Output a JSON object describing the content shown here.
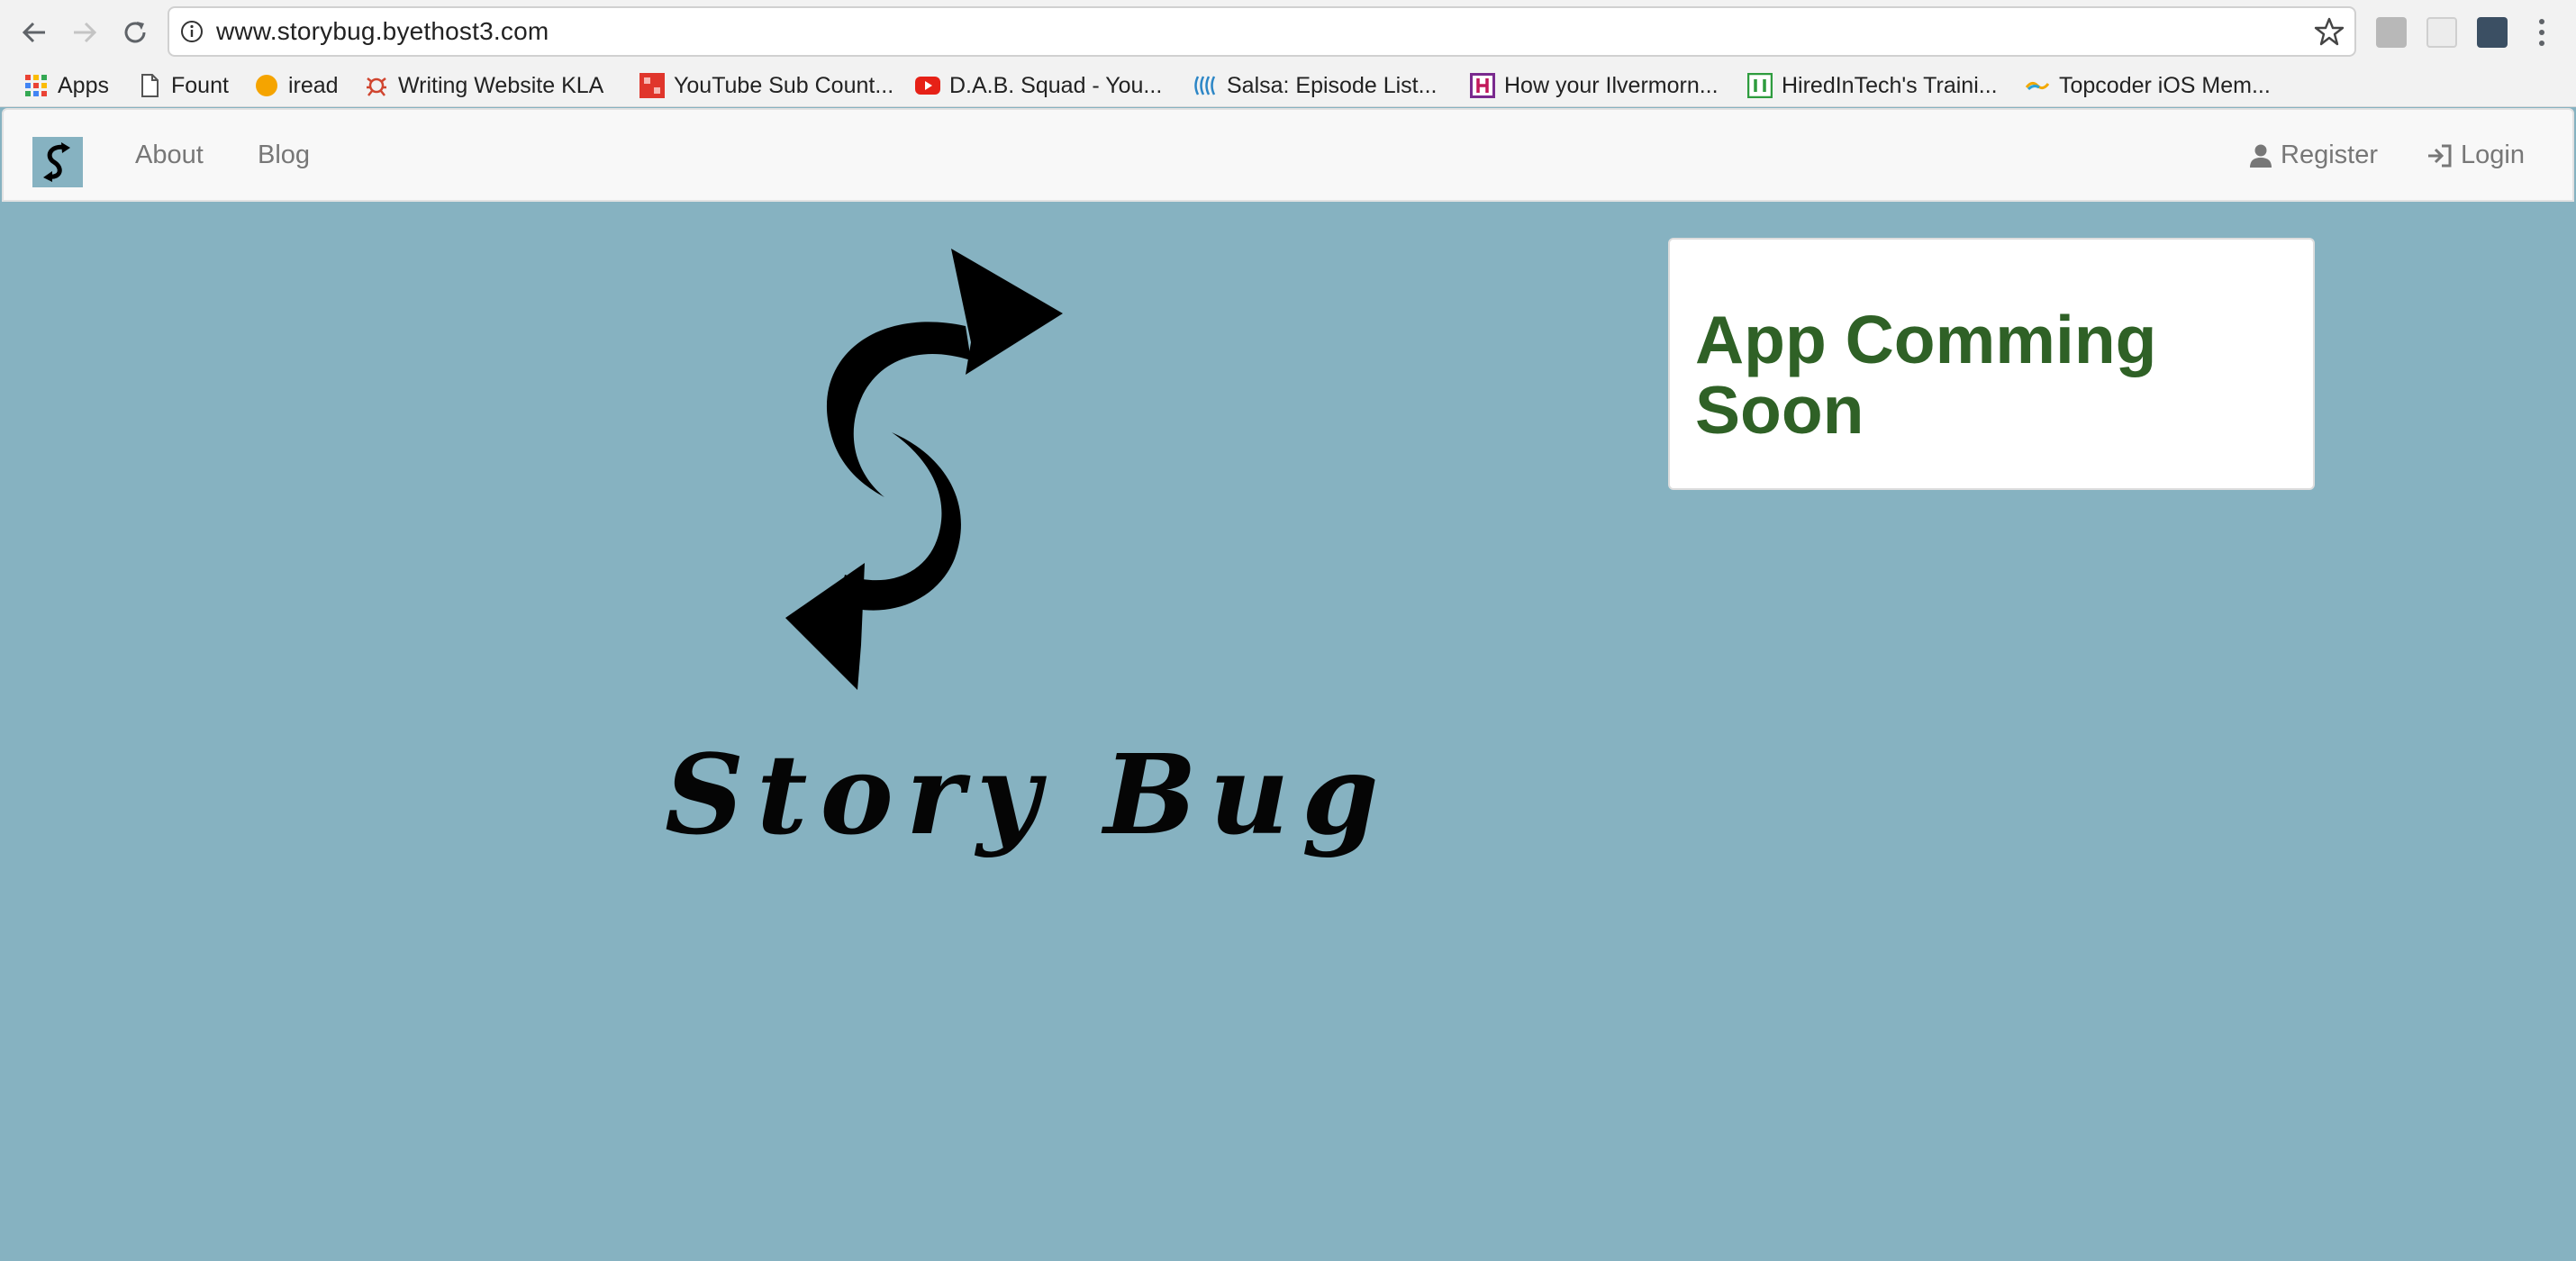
{
  "browser": {
    "url": "www.storybug.byethost3.com",
    "bookmarks": [
      {
        "label": "Apps",
        "icon": "apps-grid-icon"
      },
      {
        "label": "Fount",
        "icon": "page-icon"
      },
      {
        "label": "iread",
        "icon": "orange-dot-icon"
      },
      {
        "label": "Writing Website KLA",
        "icon": "bug-icon"
      },
      {
        "label": "YouTube Sub Count...",
        "icon": "ytsc-icon"
      },
      {
        "label": "D.A.B. Squad - You...",
        "icon": "youtube-icon"
      },
      {
        "label": "Salsa: Episode List...",
        "icon": "salsa-icon"
      },
      {
        "label": "How your Ilvermorn...",
        "icon": "h-icon"
      },
      {
        "label": "HiredInTech's Traini...",
        "icon": "hiredintech-icon"
      },
      {
        "label": "Topcoder iOS Mem...",
        "icon": "topcoder-icon"
      }
    ]
  },
  "site_nav": {
    "links": [
      "About",
      "Blog"
    ],
    "register_label": "Register",
    "login_label": "Login"
  },
  "hero": {
    "logo_text": "Story Bug"
  },
  "panel": {
    "heading": "App Comming Soon"
  },
  "colors": {
    "page_background": "#86b2c1",
    "heading_green": "#2f6126"
  }
}
